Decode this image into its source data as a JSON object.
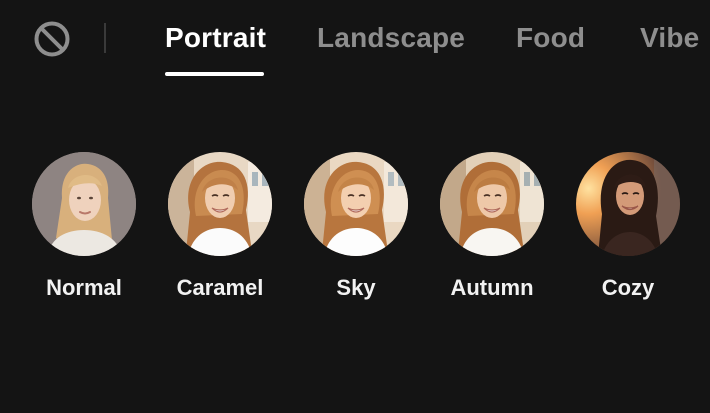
{
  "tabs": {
    "no_filter_icon": "no-symbol-icon",
    "items": [
      {
        "label": "Portrait",
        "active": true
      },
      {
        "label": "Landscape",
        "active": false
      },
      {
        "label": "Food",
        "active": false
      },
      {
        "label": "Vibe",
        "active": false
      }
    ]
  },
  "filters": {
    "selected": "Normal",
    "items": [
      {
        "label": "Normal",
        "photo": "woman-neutral-background"
      },
      {
        "label": "Caramel",
        "photo": "woman-smiling-warm"
      },
      {
        "label": "Sky",
        "photo": "woman-smiling-warm"
      },
      {
        "label": "Autumn",
        "photo": "woman-smiling-warm"
      },
      {
        "label": "Cozy",
        "photo": "woman-sunset"
      }
    ]
  },
  "colors": {
    "background": "#141414",
    "active_tab": "#ffffff",
    "inactive_tab": "#8e8e8e",
    "label": "#f2f2f2"
  }
}
